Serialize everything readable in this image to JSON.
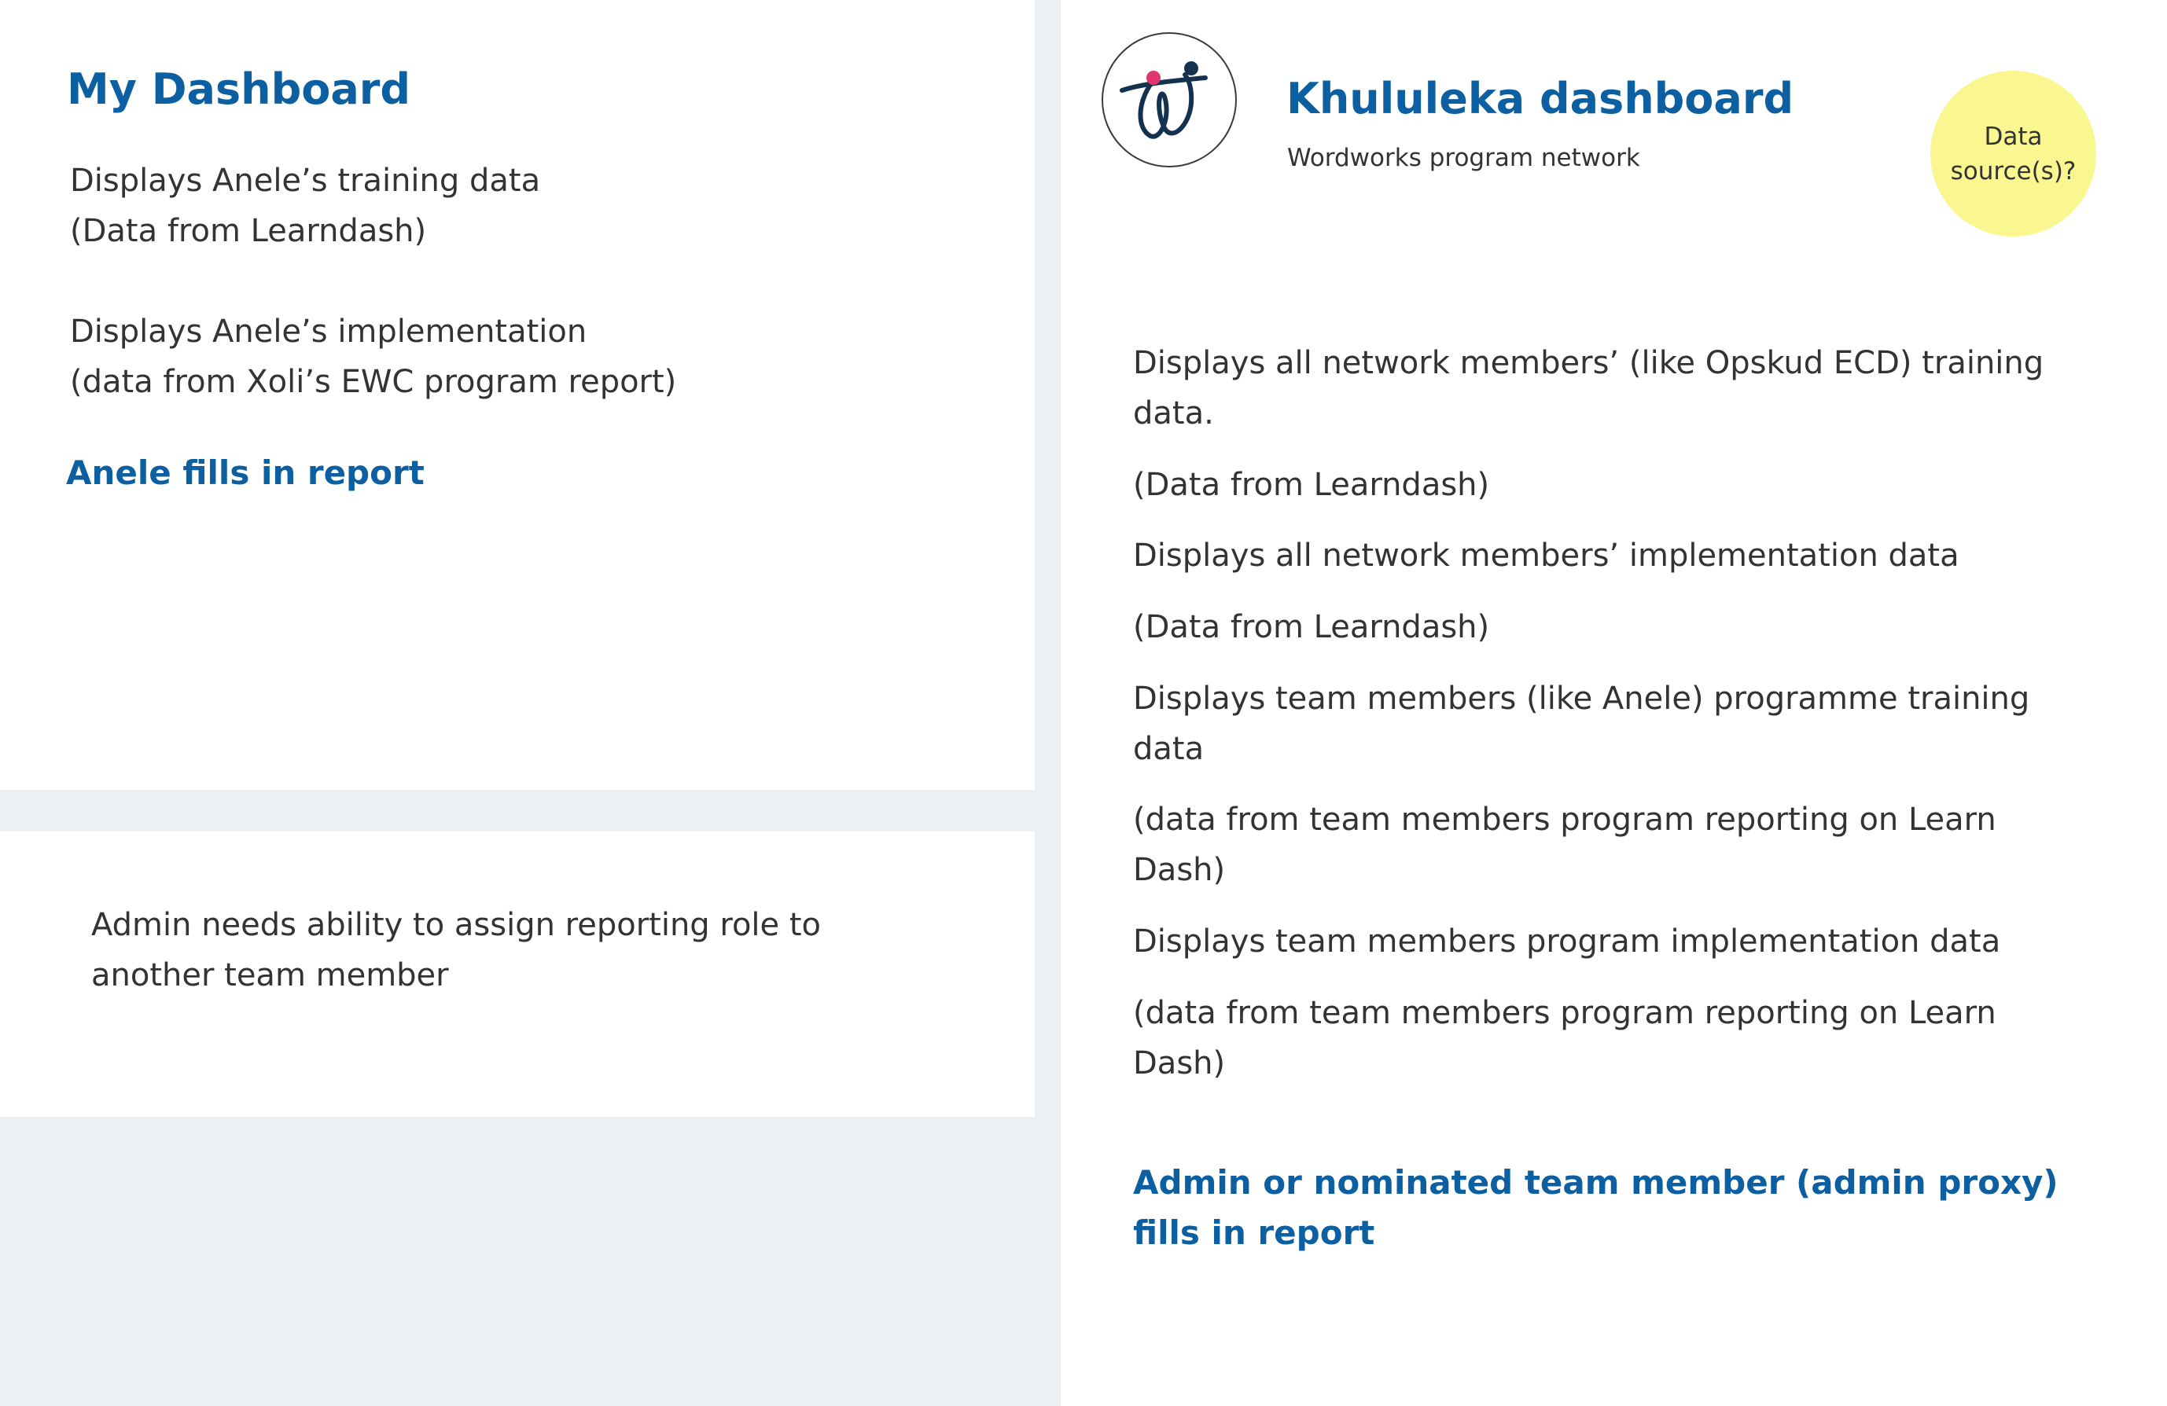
{
  "left_top": {
    "title": "My Dashboard",
    "training_lines": [
      "Displays Anele’s training data",
      "(Data from Learndash)"
    ],
    "implementation_lines": [
      "Displays Anele’s implementation",
      "(data from Xoli’s EWC  program report)"
    ],
    "action": "Anele fills in report"
  },
  "left_bottom": {
    "note_lines": [
      "Admin needs ability to assign reporting role to",
      "another team member"
    ]
  },
  "right": {
    "logo_icon": "wordworks-logo-icon",
    "title": "Khululeka dashboard",
    "subtitle": "Wordworks program network",
    "sticky_lines": [
      "Data",
      "source(s)?"
    ],
    "items": [
      [
        "Displays all network members’ (like Opskud ECD) training",
        "data."
      ],
      [
        "(Data from Learndash)"
      ],
      [
        "Displays all network members’ implementation  data"
      ],
      [
        "(Data from Learndash)"
      ],
      [
        "Displays team members (like Anele) programme training",
        "data"
      ],
      [
        "(data from team members program reporting on Learn",
        "Dash)"
      ],
      [
        "Displays team members program implementation data"
      ],
      [
        "(data from team members program reporting on Learn",
        "Dash)"
      ]
    ],
    "action_lines": [
      "Admin or nominated team member (admin proxy)",
      "fills in report"
    ]
  },
  "colors": {
    "background": "#eceff3",
    "panel": "#ffffff",
    "accent_blue": "#0c5fa0",
    "text": "#333333",
    "sticky_yellow": "#fbf790",
    "logo_pink": "#e2356b",
    "logo_navy": "#14324f"
  }
}
